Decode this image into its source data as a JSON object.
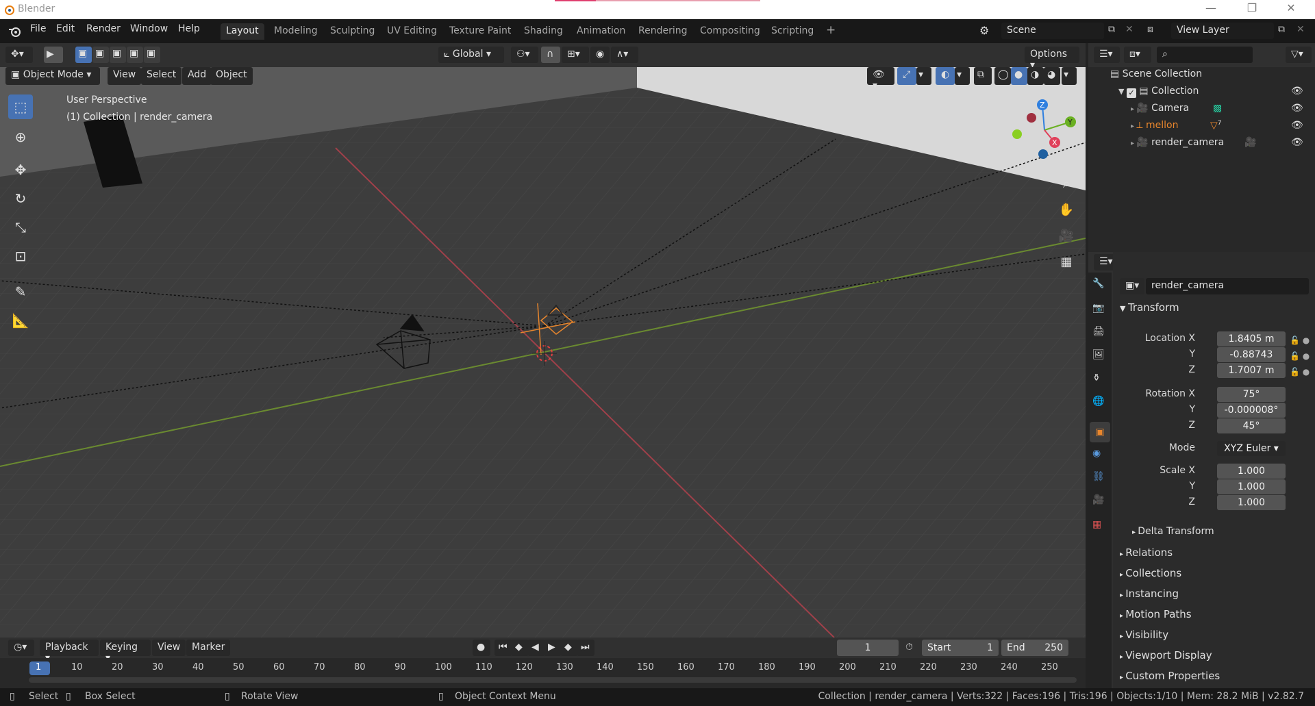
{
  "window": {
    "title": "Blender",
    "minimize": "—",
    "maximize": "❐",
    "close": "✕"
  },
  "menu": [
    "File",
    "Edit",
    "Render",
    "Window",
    "Help"
  ],
  "workspaces": [
    "Layout",
    "Modeling",
    "Sculpting",
    "UV Editing",
    "Texture Paint",
    "Shading",
    "Animation",
    "Rendering",
    "Compositing",
    "Scripting"
  ],
  "workspace_add": "+",
  "scene": {
    "name": "Scene",
    "view_layer": "View Layer"
  },
  "viewport_header": {
    "transform_orientation": "Global",
    "options": "Options",
    "mode": "Object Mode",
    "menus": [
      "View",
      "Select",
      "Add",
      "Object"
    ]
  },
  "viewport_overlay": {
    "perspective": "User Perspective",
    "context": "(1) Collection | render_camera"
  },
  "gizmo": {
    "x": "X",
    "y": "Y",
    "z": "Z"
  },
  "outliner": {
    "root": "Scene Collection",
    "collection": "Collection",
    "items": [
      {
        "name": "Camera",
        "color": "#dedede"
      },
      {
        "name": "mellon",
        "color": "#e8862d"
      },
      {
        "name": "render_camera",
        "color": "#dedede"
      }
    ],
    "mellon_badge": "7"
  },
  "properties": {
    "object_name_header": "render_camera",
    "object_name_field": "render_camera",
    "transform_title": "Transform",
    "location_label": "Location X",
    "location": [
      "1.8405 m",
      "-0.88743",
      "1.7007 m"
    ],
    "rotation_label": "Rotation X",
    "rotation": [
      "75°",
      "-0.000008°",
      "45°"
    ],
    "mode_label": "Mode",
    "mode_value": "XYZ Euler",
    "scale_label": "Scale X",
    "scale": [
      "1.000",
      "1.000",
      "1.000"
    ],
    "axis_y": "Y",
    "axis_z": "Z",
    "delta": "Delta Transform",
    "panels": [
      "Relations",
      "Collections",
      "Instancing",
      "Motion Paths",
      "Visibility",
      "Viewport Display",
      "Custom Properties"
    ]
  },
  "timeline": {
    "menus": [
      "Playback",
      "Keying",
      "View",
      "Marker"
    ],
    "current_frame": "1",
    "start_label": "Start",
    "start": "1",
    "end_label": "End",
    "end": "250",
    "ruler": [
      "1",
      "10",
      "20",
      "30",
      "40",
      "50",
      "60",
      "70",
      "80",
      "90",
      "100",
      "110",
      "120",
      "130",
      "140",
      "150",
      "160",
      "170",
      "180",
      "190",
      "200",
      "210",
      "220",
      "230",
      "240",
      "250"
    ]
  },
  "statusbar": {
    "select": "Select",
    "box_select": "Box Select",
    "rotate_view": "Rotate View",
    "context_menu": "Object Context Menu",
    "stats": "Collection | render_camera | Verts:322 | Faces:196 | Tris:196 | Objects:1/10 | Mem: 28.2 MiB | v2.82.7"
  },
  "colors": {
    "accent": "#4772b3",
    "x_axis": "#c0404a",
    "y_axis": "#6a9a30",
    "selected": "#e8862d"
  }
}
